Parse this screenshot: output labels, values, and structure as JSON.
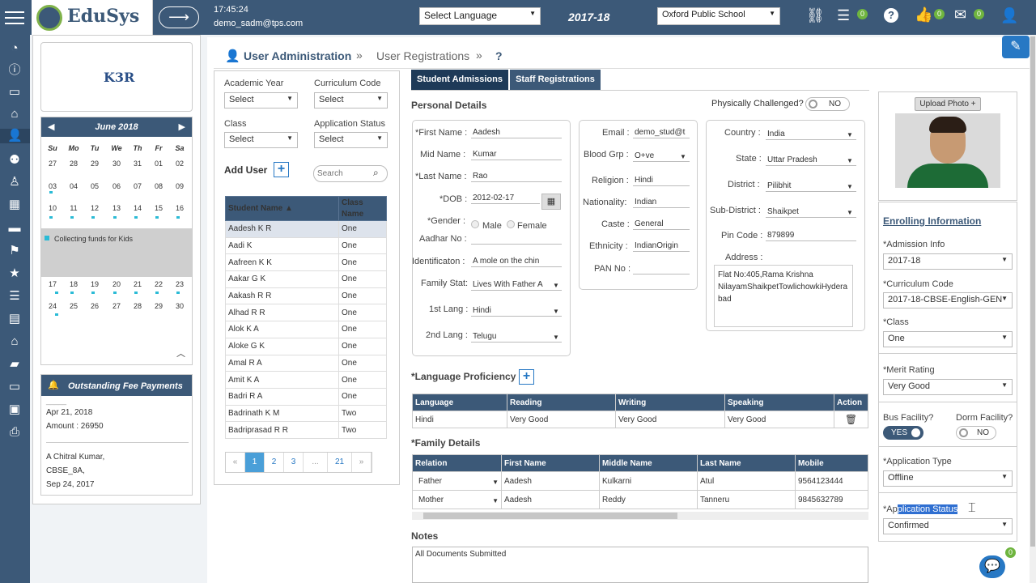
{
  "topbar": {
    "brand": "EduSys",
    "time": "17:45:24",
    "user": "demo_sadm@tps.com",
    "language": "Select Language",
    "year": "2017-18",
    "school": "Oxford Public School",
    "badge1": "0",
    "badge2": "0",
    "badge3": "0",
    "colors": {
      "primary": "#3c5978",
      "accent": "#2778c4",
      "badge": "#6fb53f"
    }
  },
  "sidebar": {
    "icons": [
      "dashboard-icon",
      "info-icon",
      "monitor-icon",
      "bank-icon",
      "user-admin-icon",
      "group-icon",
      "person-icon",
      "calculator-icon",
      "card-icon",
      "flag-icon",
      "star-icon",
      "list-icon",
      "document-icon",
      "graduation-icon",
      "book-icon",
      "bed-icon",
      "bus-icon",
      "print-icon"
    ]
  },
  "left": {
    "logo": "K3R",
    "calendar": {
      "month": "June 2018",
      "days": [
        "Su",
        "Mo",
        "Tu",
        "We",
        "Th",
        "Fr",
        "Sa"
      ],
      "weeks": [
        [
          "27",
          "28",
          "29",
          "30",
          "31",
          "01",
          "02"
        ],
        [
          "03",
          "04",
          "05",
          "06",
          "07",
          "08",
          "09"
        ],
        [
          "10",
          "11",
          "12",
          "13",
          "14",
          "15",
          "16"
        ],
        [
          "17",
          "18",
          "19",
          "20",
          "21",
          "22",
          "23"
        ],
        [
          "24",
          "25",
          "26",
          "27",
          "28",
          "29",
          "30"
        ]
      ],
      "event": "Collecting funds for Kids"
    },
    "fees": {
      "title": "Outstanding Fee Payments",
      "cut": "_____",
      "date1": "Apr 21, 2018",
      "amount": "Amount : 26950",
      "name2": "A Chitral Kumar,",
      "class2": "CBSE_8A,",
      "date2": "Sep 24, 2017"
    }
  },
  "breadcrumb": {
    "title": "User Administration",
    "sep1": "»",
    "sub": "User Registrations",
    "sep2": "»",
    "help": "?"
  },
  "filters": {
    "academic_year": "Academic Year",
    "curriculum_code": "Curriculum Code",
    "class": "Class",
    "application_status": "Application Status",
    "select": "Select",
    "add_user": "Add User",
    "search_placeholder": "Search"
  },
  "students": {
    "col1": "Student Name",
    "col2": "Class Name",
    "rows": [
      [
        "Aadesh K R",
        "One"
      ],
      [
        "Aadi K",
        "One"
      ],
      [
        "Aafreen K K",
        "One"
      ],
      [
        "Aakar G K",
        "One"
      ],
      [
        "Aakash R R",
        "One"
      ],
      [
        "Alhad R R",
        "One"
      ],
      [
        "Alok K A",
        "One"
      ],
      [
        "Aloke G K",
        "One"
      ],
      [
        "Amal R A",
        "One"
      ],
      [
        "Amit K A",
        "One"
      ],
      [
        "Badri R A",
        "One"
      ],
      [
        "Badrinath K M",
        "Two"
      ],
      [
        "Badriprasad R R",
        "Two"
      ]
    ]
  },
  "pagination": {
    "prev": "«",
    "pages": [
      "1",
      "2",
      "3",
      "...",
      "21"
    ],
    "next": "»"
  },
  "tabs": {
    "student": "Student Admissions",
    "staff": "Staff Registrations"
  },
  "personal": {
    "heading": "Personal Details",
    "physically": "Physically Challenged?",
    "toggle_no": "NO",
    "first_name_lbl": "*First Name :",
    "first_name": "Aadesh",
    "mid_name_lbl": "Mid Name :",
    "mid_name": "Kumar",
    "last_name_lbl": "*Last Name :",
    "last_name": "Rao",
    "dob_lbl": "*DOB :",
    "dob": "2012-02-17",
    "gender_lbl": "*Gender :",
    "male": "Male",
    "female": "Female",
    "aadhar_lbl": "Aadhar No :",
    "ident_lbl": "Identificaton :",
    "ident": "A mole on the chin",
    "family_lbl": "Family Stat:",
    "family": "Lives With Father A",
    "lang1_lbl": "1st Lang :",
    "lang1": "Hindi",
    "lang2_lbl": "2nd Lang :",
    "lang2": "Telugu"
  },
  "contact": {
    "email_lbl": "Email :",
    "email": "demo_stud@t",
    "blood_lbl": "Blood Grp :",
    "blood": "O+ve",
    "religion_lbl": "Religion :",
    "religion": "Hindi",
    "nationality_lbl": "Nationality:",
    "nationality": "Indian",
    "caste_lbl": "Caste :",
    "caste": "General",
    "ethnicity_lbl": "Ethnicity :",
    "ethnicity": "IndianOrigin",
    "pan_lbl": "PAN No :"
  },
  "address": {
    "country_lbl": "Country :",
    "country": "India",
    "state_lbl": "State :",
    "state": "Uttar Pradesh",
    "district_lbl": "District :",
    "district": "Pilibhit",
    "subdistrict_lbl": "Sub-District :",
    "subdistrict": "Shaikpet",
    "pincode_lbl": "Pin Code :",
    "pincode": "879899",
    "address_lbl": "Address :",
    "address_line1": "Flat No:405,Rama Krishna",
    "address_line2": "NilayamShaikpetTowlichowkiHydera",
    "address_line3": "bad"
  },
  "language": {
    "heading": "*Language Proficiency",
    "cols": [
      "Language",
      "Reading",
      "Writing",
      "Speaking",
      "Action"
    ],
    "row": [
      "Hindi",
      "Very Good",
      "Very Good",
      "Very Good"
    ]
  },
  "family": {
    "heading": "*Family Details",
    "cols": [
      "Relation",
      "First Name",
      "Middle Name",
      "Last Name",
      "Mobile"
    ],
    "rows": [
      [
        "Father",
        "Aadesh",
        "Kulkarni",
        "Atul",
        "9564123444"
      ],
      [
        "Mother",
        "Aadesh",
        "Reddy",
        "Tanneru",
        "9845632789"
      ]
    ]
  },
  "notes": {
    "heading": "Notes",
    "text": "All Documents Submitted"
  },
  "photo": {
    "upload": "Upload Photo +"
  },
  "enrolling": {
    "heading": "Enrolling Information",
    "admission_lbl": "*Admission Info",
    "admission": "2017-18",
    "curriculum_lbl": "*Curriculum Code",
    "curriculum": "2017-18-CBSE-English-GEN",
    "class_lbl": "*Class",
    "class": "One",
    "merit_lbl": "*Merit Rating",
    "merit": "Very Good",
    "bus_lbl": "Bus Facility?",
    "bus": "YES",
    "dorm_lbl": "Dorm Facility?",
    "dorm": "NO",
    "apptype_lbl": "*Application Type",
    "apptype": "Offline",
    "appstatus_lbl_a": "*Ap",
    "appstatus_lbl_b": "plication Status",
    "appstatus": "Confirmed"
  },
  "chat": {
    "badge": "0"
  }
}
